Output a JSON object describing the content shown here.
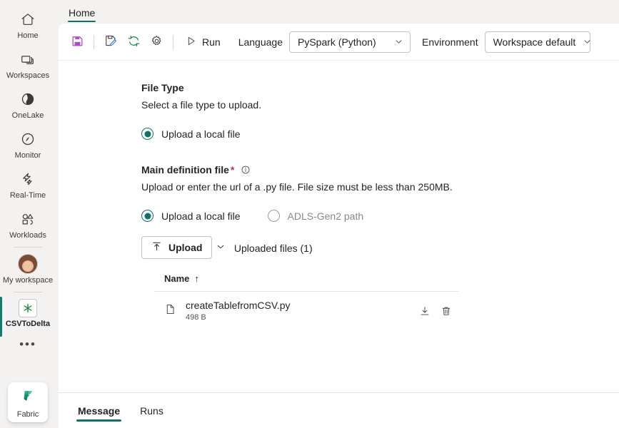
{
  "sidebar": {
    "items": [
      {
        "label": "Home",
        "icon": "home-icon"
      },
      {
        "label": "Workspaces",
        "icon": "workspaces-icon"
      },
      {
        "label": "OneLake",
        "icon": "onelake-icon"
      },
      {
        "label": "Monitor",
        "icon": "monitor-icon"
      },
      {
        "label": "Real-Time",
        "icon": "real-time-icon"
      },
      {
        "label": "Workloads",
        "icon": "workloads-icon"
      }
    ],
    "workspace": {
      "label": "My workspace",
      "icon": "avatar"
    },
    "artifact": {
      "label": "CSVToDelta",
      "icon": "spark-job-definition-icon"
    },
    "more_label": "•••",
    "product": {
      "label": "Fabric",
      "icon": "fabric-logo"
    },
    "accent": "#107c6e"
  },
  "ribbon": {
    "tabs": [
      {
        "label": "Home",
        "active": true
      }
    ]
  },
  "toolbar": {
    "save_icon": "save-icon",
    "edit_icon": "edit-icon",
    "refresh_icon": "refresh-icon",
    "settings_icon": "gear-icon",
    "run_label": "Run",
    "run_icon": "play-icon",
    "language_label": "Language",
    "language_value": "PySpark (Python)",
    "environment_label": "Environment",
    "environment_value": "Workspace default"
  },
  "form": {
    "file_type": {
      "title": "File Type",
      "subtitle": "Select a file type to upload.",
      "option_label": "Upload a local file",
      "checked": true
    },
    "main_definition": {
      "title": "Main definition file",
      "required_mark": "*",
      "info_icon": "info-icon",
      "subtitle": "Upload or enter the url of a .py file. File size must be less than 250MB.",
      "options": [
        {
          "label": "Upload a local file",
          "checked": true,
          "disabled": false
        },
        {
          "label": "ADLS-Gen2 path",
          "checked": false,
          "disabled": true
        }
      ],
      "upload_button": {
        "label": "Upload",
        "icon": "upload-icon"
      },
      "collapse": {
        "label": "Uploaded files (1)",
        "icon": "chevron-down-icon",
        "expanded": true
      }
    },
    "file_table": {
      "columns": [
        {
          "label": "Name",
          "sort": "↑"
        }
      ],
      "rows": [
        {
          "icon": "file-icon",
          "name": "createTablefromCSV.py",
          "size": "498 B",
          "actions": [
            {
              "name": "download-icon"
            },
            {
              "name": "delete-icon"
            }
          ]
        }
      ]
    }
  },
  "bottom_tabs": [
    {
      "label": "Message",
      "active": true
    },
    {
      "label": "Runs",
      "active": false
    }
  ]
}
